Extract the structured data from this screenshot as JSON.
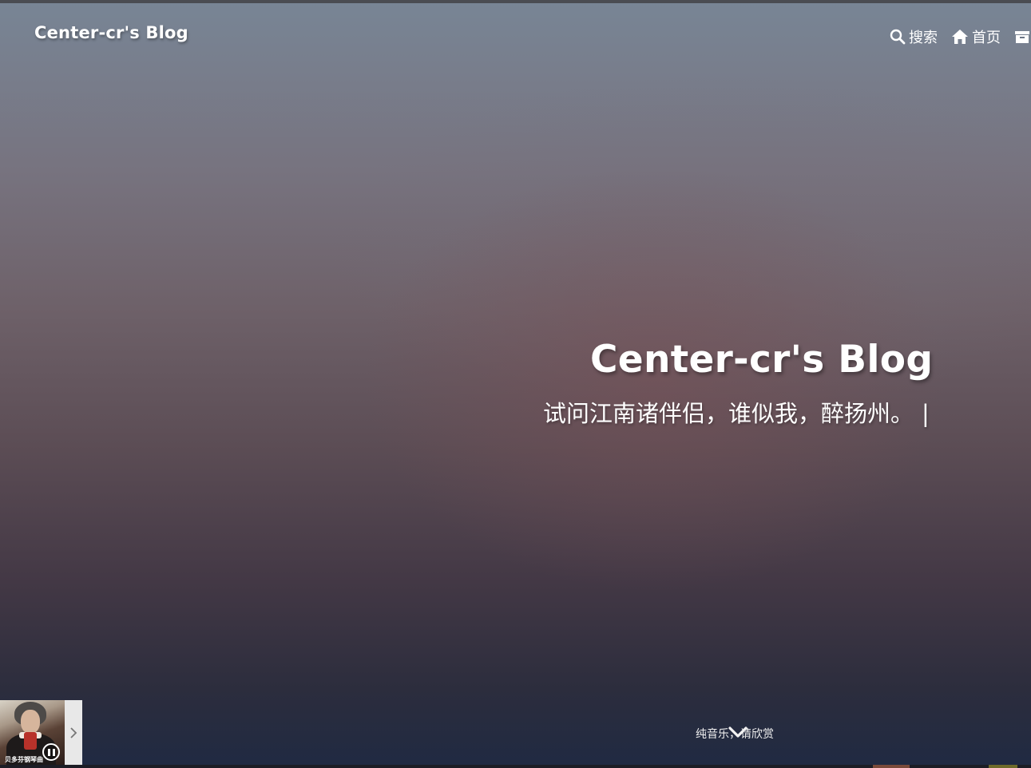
{
  "header": {
    "brand": "Center-cr's Blog",
    "nav": [
      {
        "label": "搜索",
        "icon": "search-icon"
      },
      {
        "label": "首页",
        "icon": "home-icon"
      },
      {
        "label": "",
        "icon": "archive-icon"
      }
    ]
  },
  "hero": {
    "title": "Center-cr's Blog",
    "subtitle": "试问江南诸伴侣，谁似我，醉扬州。",
    "cursor": "|"
  },
  "player": {
    "caption": "贝多芬钢琴曲",
    "state_icon": "pause-icon",
    "toggle_icon": "chevron-right-icon"
  },
  "footer": {
    "music_hint": "纯音乐，请欣赏",
    "scroll_icon": "chevron-down-icon"
  },
  "colors": {
    "top": "#788595",
    "middle": "#6e6169",
    "bottom": "#202a42"
  }
}
